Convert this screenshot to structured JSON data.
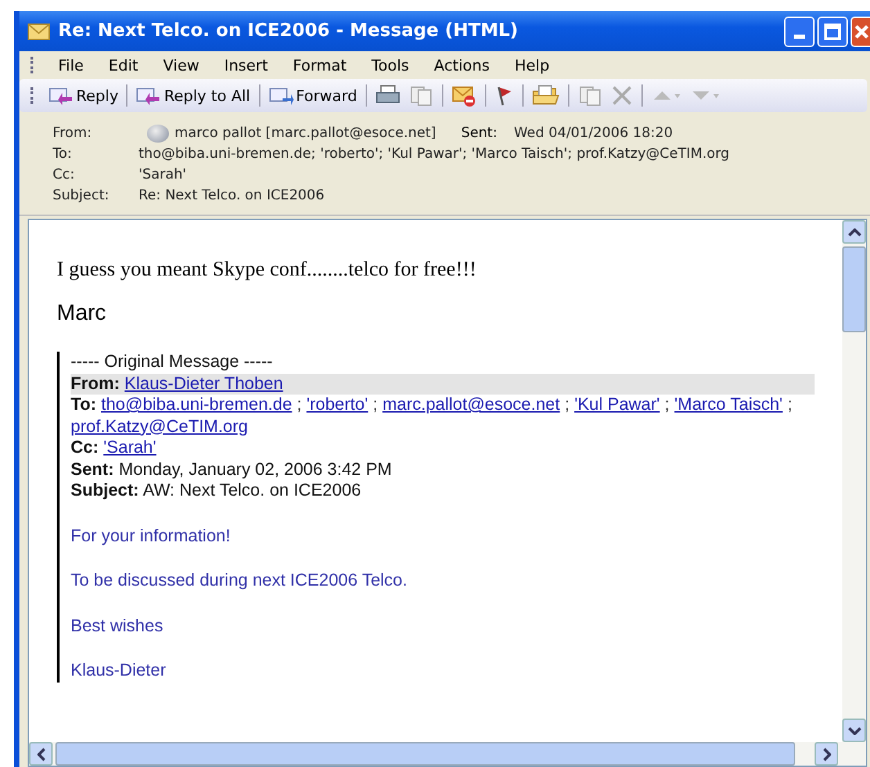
{
  "window": {
    "title": "Re: Next Telco. on ICE2006 - Message (HTML)"
  },
  "menu": [
    "File",
    "Edit",
    "View",
    "Insert",
    "Format",
    "Tools",
    "Actions",
    "Help"
  ],
  "toolbar": [
    {
      "kind": "reply",
      "label": "Reply"
    },
    {
      "kind": "reply_all",
      "label": "Reply to All"
    },
    {
      "kind": "forward",
      "label": "Forward"
    },
    {
      "kind": "print"
    },
    {
      "kind": "copy"
    },
    {
      "kind": "unread"
    },
    {
      "kind": "flag"
    },
    {
      "kind": "move"
    },
    {
      "kind": "paste"
    },
    {
      "kind": "delete"
    },
    {
      "kind": "up"
    },
    {
      "kind": "down"
    }
  ],
  "header": {
    "from_label": "From:",
    "from": "marco pallot [marc.pallot@esoce.net]",
    "sent_label": "Sent:",
    "sent": "Wed 04/01/2006 18:20",
    "to_label": "To:",
    "to": "tho@biba.uni-bremen.de; 'roberto'; 'Kul Pawar'; 'Marco Taisch'; prof.Katzy@CeTIM.org",
    "cc_label": "Cc:",
    "cc": "'Sarah'",
    "subject_label": "Subject:",
    "subject": "Re: Next Telco. on ICE2006"
  },
  "body": {
    "text": "I guess you meant Skype conf........telco for free!!!",
    "signature": "Marc"
  },
  "original": {
    "heading": "----- Original Message -----",
    "from_label": "From:",
    "from": "Klaus-Dieter Thoben",
    "to_label": "To:",
    "to_separator": ";",
    "to": [
      "tho@biba.uni-bremen.de",
      "'roberto'",
      "marc.pallot@esoce.net",
      "'Kul Pawar'",
      "'Marco Taisch'",
      "prof.Katzy@CeTIM.org"
    ],
    "cc_label": "Cc:",
    "cc": "'Sarah'",
    "sent_label": "Sent:",
    "sent": "Monday, January 02, 2006 3:42 PM",
    "subject_label": "Subject:",
    "subject": "AW: Next Telco. on ICE2006",
    "paragraphs": [
      "For your information!",
      "To be discussed during next ICE2006 Telco.",
      "Best wishes",
      "Klaus-Dieter"
    ]
  }
}
